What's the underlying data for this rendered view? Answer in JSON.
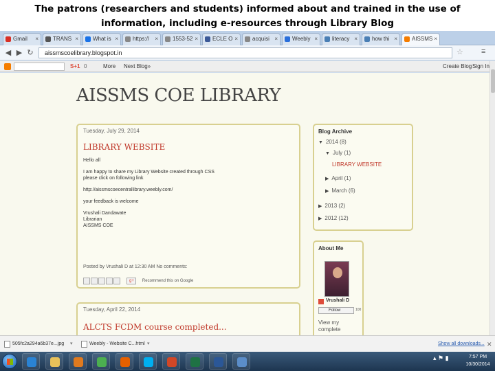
{
  "caption": {
    "line1": "The patrons (researchers and students) informed about and trained in the use of",
    "line2": "information, including e-resources  through Library Blog"
  },
  "browser": {
    "tabs": [
      {
        "label": "Gmail",
        "color": "#d93025"
      },
      {
        "label": "TRANS",
        "color": "#555555"
      },
      {
        "label": "What is",
        "color": "#1a73e8"
      },
      {
        "label": "https://",
        "color": "#888888"
      },
      {
        "label": "1553-52",
        "color": "#888888"
      },
      {
        "label": "ECLE O",
        "color": "#3b5998"
      },
      {
        "label": "acquisi",
        "color": "#888888"
      },
      {
        "label": "Weebly",
        "color": "#2a6fdb"
      },
      {
        "label": "literacy",
        "color": "#4a7fb5"
      },
      {
        "label": "how thi",
        "color": "#4a7fb5"
      },
      {
        "label": "AISSMS",
        "color": "#f57d00"
      }
    ],
    "url": "aissmscoelibrary.blogspot.in",
    "icons": {
      "back": "back-arrow-icon",
      "forward": "forward-arrow-icon",
      "reload": "reload-icon",
      "star": "star-icon",
      "menu": "wrench-menu-icon"
    }
  },
  "navbar": {
    "gplus": "S+1",
    "count": "0",
    "more": "More",
    "next_blog": "Next Blog»",
    "create_blog": "Create Blog",
    "sign_in": "Sign In"
  },
  "blog": {
    "title": "AISSMS COE LIBRARY",
    "posts": [
      {
        "date": "Tuesday, July 29, 2014",
        "title": "LIBRARY WEBSITE",
        "greeting": "Hello all",
        "body1": "I am happy to share my Library Website created through CSS",
        "body2": "please click on following link",
        "link": "http://aissmscoecentrallibrary.weebly.com/",
        "feedback": "your feedback is welcome",
        "sign_name": "Vrushali Dandawate",
        "sign_role": "Librarian",
        "sign_org": "AISSMS COE",
        "footer": "Posted by Vrushali D at 12:30 AM    No comments:",
        "recommend": "Recommend this on Google"
      },
      {
        "date": "Tuesday, April 22, 2014",
        "title": "ALCTS FCDM course completed..."
      }
    ],
    "archive": {
      "title": "Blog Archive",
      "items": [
        {
          "label": "2014 (8)",
          "level": 0,
          "expanded": true
        },
        {
          "label": "July (1)",
          "level": 1,
          "expanded": true
        },
        {
          "label": "LIBRARY WEBSITE",
          "level": 2,
          "link": true
        },
        {
          "label": "April (1)",
          "level": 1,
          "expanded": false
        },
        {
          "label": "March (6)",
          "level": 1,
          "expanded": false
        },
        {
          "label": "2013 (2)",
          "level": 0,
          "expanded": false
        },
        {
          "label": "2012 (12)",
          "level": 0,
          "expanded": false
        }
      ]
    },
    "about": {
      "title": "About Me",
      "name": "Vrushali D",
      "follow": "Follow",
      "follow_count": "100",
      "view_profile": "View my complete"
    }
  },
  "downloads": {
    "items": [
      {
        "label": "505fc2a294a6b37e...jpg"
      },
      {
        "label": "Weebly - Website C...html"
      }
    ],
    "show_all": "Show all downloads..."
  },
  "taskbar": {
    "apps": [
      {
        "name": "ie-icon",
        "color": "#2a83d4"
      },
      {
        "name": "explorer-folder-icon",
        "color": "#e8c15a"
      },
      {
        "name": "media-player-icon",
        "color": "#e07a1f"
      },
      {
        "name": "chrome-icon",
        "color": "#4caf50"
      },
      {
        "name": "firefox-icon",
        "color": "#e66000"
      },
      {
        "name": "skype-icon",
        "color": "#00aff0"
      },
      {
        "name": "powerpoint-icon",
        "color": "#d24726"
      },
      {
        "name": "excel-icon",
        "color": "#1f7244"
      },
      {
        "name": "word-icon",
        "color": "#2b5797"
      },
      {
        "name": "remote-desktop-icon",
        "color": "#5b8dc9"
      }
    ],
    "time": "7:57 PM",
    "date": "10/30/2014"
  }
}
